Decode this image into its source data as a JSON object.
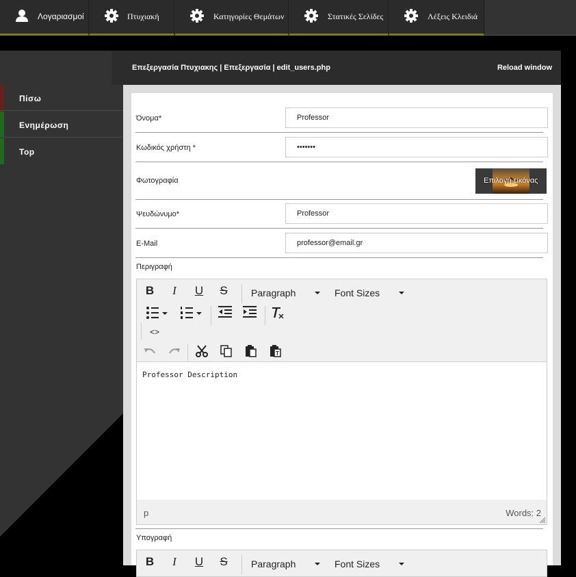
{
  "nav": {
    "tabs": [
      {
        "label": "Λογαριασμοί",
        "icon": "user-icon"
      },
      {
        "label": "Πτυχιακή",
        "icon": "gear-icon"
      },
      {
        "label": "Κατηγορίες Θεμάτων",
        "icon": "gear-icon"
      },
      {
        "label": "Στατικές Σελίδες",
        "icon": "gear-icon"
      },
      {
        "label": "Λέξεις Κλειδιά",
        "icon": "gear-icon"
      }
    ],
    "accent_color": "#7d7d1e"
  },
  "sidebar": {
    "items": [
      {
        "label": "Πίσω",
        "color": "#6b1e1e"
      },
      {
        "label": "Ενημέρωση",
        "color": "#1e6b1e"
      },
      {
        "label": "Top",
        "color": "#1e6b1e"
      }
    ]
  },
  "panel": {
    "title": "Επεξεργασία Πτυχιακης | Επεξεργασία | edit_users.php",
    "reload_label": "Reload window"
  },
  "form": {
    "name": {
      "label": "Όνομα*",
      "value": "Professor"
    },
    "password": {
      "label": "Κωδικός χρήστη *",
      "value": "•••••••"
    },
    "photo": {
      "label": "Φωτογραφία",
      "button_label": "Επιλογή εικόνας"
    },
    "nickname": {
      "label": "Ψευδώνυμο*",
      "value": "Professor"
    },
    "email": {
      "label": "E-Mail",
      "value": "professor@email.gr"
    },
    "description": {
      "label": "Περιγραφή",
      "content": "Professor Description",
      "status_path": "p",
      "word_count": "Words: 2"
    },
    "signature": {
      "label": "Υπογραφή"
    }
  },
  "editor_toolbar": {
    "format_select": "Paragraph",
    "size_select": "Font Sizes",
    "code_label": "<>"
  }
}
